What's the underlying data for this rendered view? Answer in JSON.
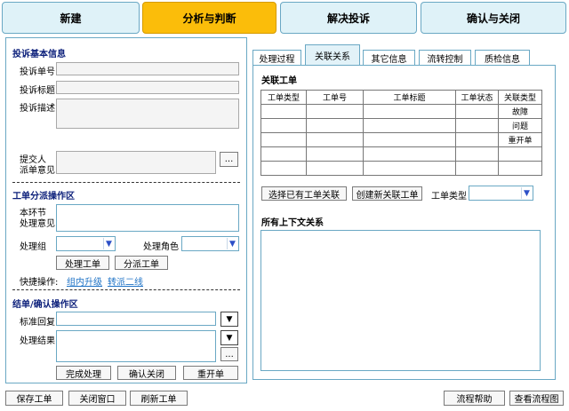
{
  "steps": [
    {
      "label": "新建",
      "active": false
    },
    {
      "label": "分析与判断",
      "active": true
    },
    {
      "label": "解决投诉",
      "active": false
    },
    {
      "label": "确认与关闭",
      "active": false
    }
  ],
  "basic_info": {
    "title": "投诉基本信息",
    "order_no_label": "投诉单号",
    "subject_label": "投诉标题",
    "desc_label": "投诉描述",
    "submitter_label_1": "提交人",
    "submitter_label_2": "派单意见",
    "more_button": "..."
  },
  "dispatch": {
    "title": "工单分派操作区",
    "opinion_label_1": "本环节",
    "opinion_label_2": "处理意见",
    "group_label": "处理组",
    "role_label": "处理角色",
    "process_button": "处理工单",
    "dispatch_button": "分派工单",
    "shortcut_label": "快捷操作:",
    "shortcut_link_1": "组内升级",
    "shortcut_link_2": "转派二线"
  },
  "closure": {
    "title": "结单/确认操作区",
    "standard_reply_label": "标准回复",
    "result_label": "处理结果",
    "more_button": "...",
    "complete_button": "完成处理",
    "confirm_close_button": "确认关闭",
    "reopen_button": "重开单"
  },
  "inner_tabs": [
    "处理过程",
    "关联关系",
    "其它信息",
    "流转控制",
    "质检信息"
  ],
  "inner_tab_active": 1,
  "related": {
    "title": "关联工单",
    "columns": [
      "工单类型",
      "工单号",
      "工单标题",
      "工单状态",
      "关联类型"
    ],
    "rows": [
      [
        "",
        "",
        "",
        "",
        "故障"
      ],
      [
        "",
        "",
        "",
        "",
        "问题"
      ],
      [
        "",
        "",
        "",
        "",
        "重开单"
      ],
      [
        "",
        "",
        "",
        "",
        ""
      ],
      [
        "",
        "",
        "",
        "",
        ""
      ]
    ],
    "select_existing_button": "选择已有工单关联",
    "create_new_button": "创建新关联工单",
    "type_label": "工单类型",
    "context_title": "所有上下文关系"
  },
  "footer": {
    "save_button": "保存工单",
    "close_window_button": "关闭窗口",
    "refresh_button": "刷新工单",
    "help_button": "流程帮助",
    "view_flow_button": "查看流程图"
  },
  "colors": {
    "active_step": "#fbbd0a",
    "step_bg": "#dff2f8",
    "border": "#6aa8c4",
    "section_title": "#0b1f7a",
    "link": "#1f73c6"
  }
}
